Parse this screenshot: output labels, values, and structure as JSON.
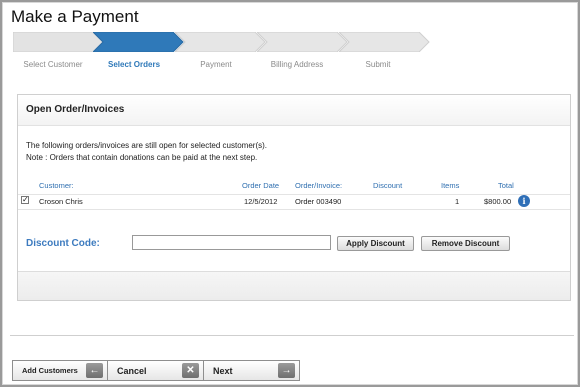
{
  "page": {
    "title": "Make a Payment"
  },
  "wizard": {
    "steps": [
      {
        "label": "Select Customer",
        "active": false
      },
      {
        "label": "Select Orders",
        "active": true
      },
      {
        "label": "Payment",
        "active": false
      },
      {
        "label": "Billing Address",
        "active": false
      },
      {
        "label": "Submit",
        "active": false
      }
    ]
  },
  "panel": {
    "title": "Open Order/Invoices",
    "message_line1": "The following orders/invoices are still open for selected customer(s).",
    "message_line2": "Note : Orders that contain donations can be paid at the next step."
  },
  "table": {
    "columns": [
      "Customer:",
      "Order Date",
      "Order/Invoice:",
      "Discount",
      "Items",
      "Total"
    ],
    "rows": [
      {
        "checked": true,
        "customer": "Croson Chris",
        "order_date": "12/5/2012",
        "order_invoice": "Order 003490",
        "discount": "",
        "items": "1",
        "total": "$800.00"
      }
    ]
  },
  "discount": {
    "label": "Discount Code:",
    "value": "",
    "apply_label": "Apply Discount",
    "remove_label": "Remove Discount"
  },
  "toolbar": {
    "add_customers_label": "Add Customers",
    "cancel_label": "Cancel",
    "next_label": "Next"
  },
  "colors": {
    "accent": "#2f79b9",
    "link_blue": "#2f6fb0",
    "step_inactive": "#e4e4e4"
  }
}
